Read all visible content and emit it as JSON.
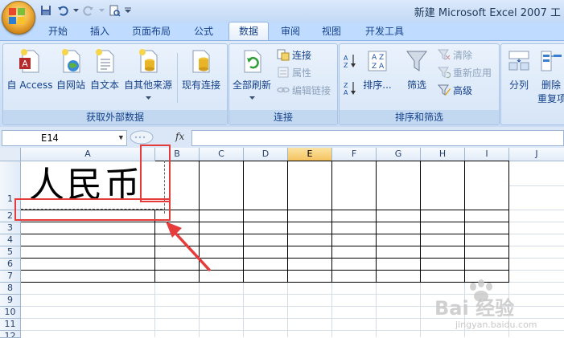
{
  "window": {
    "title": "新建 Microsoft Excel 2007 工"
  },
  "quick_access": {
    "icons": [
      "save-icon",
      "undo-icon",
      "redo-icon",
      "print-preview-icon"
    ]
  },
  "tabs": [
    {
      "label": "开始"
    },
    {
      "label": "插入"
    },
    {
      "label": "页面布局"
    },
    {
      "label": "公式"
    },
    {
      "label": "数据",
      "active": true
    },
    {
      "label": "审阅"
    },
    {
      "label": "视图"
    },
    {
      "label": "开发工具"
    }
  ],
  "ribbon": {
    "groups": {
      "external": {
        "label": "获取外部数据",
        "buttons": [
          "自 Access",
          "自网站",
          "自文本",
          "自其他来源",
          "现有连接"
        ]
      },
      "connections": {
        "label": "连接",
        "refresh_line1": "全部刷新",
        "connect": "连接",
        "properties": "属性",
        "edit_links": "编辑链接"
      },
      "sort_filter": {
        "label": "排序和筛选",
        "sort": "排序...",
        "filter": "筛选",
        "clear": "清除",
        "reapply": "重新应用",
        "advanced": "高级"
      },
      "tools": {
        "split": "分列",
        "remove_line1": "删除",
        "remove_line2": "重复项"
      }
    }
  },
  "formula_bar": {
    "name_box": "E14",
    "fx": "fx",
    "formula": ""
  },
  "sheet": {
    "columns": [
      "A",
      "B",
      "C",
      "D",
      "E",
      "F",
      "G",
      "H",
      "I",
      "J"
    ],
    "selected_column": "E",
    "rows": [
      "1",
      "2",
      "3",
      "4",
      "5",
      "6",
      "7",
      "8",
      "9",
      "10",
      "11",
      "12"
    ],
    "cell_A1": "人民币"
  },
  "watermark": {
    "text": "Bai 经验",
    "url": "jingyan.baidu.com"
  },
  "colors": {
    "annotation_red": "#e53b3b",
    "selected_header": "#f5c360"
  }
}
